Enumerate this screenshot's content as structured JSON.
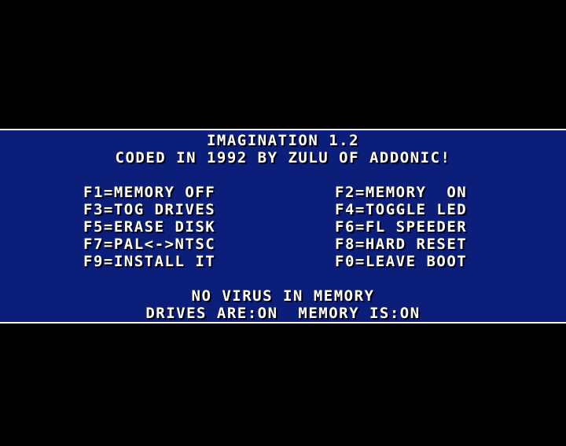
{
  "title": "IMAGINATION 1.2",
  "credit": "CODED IN 1992 BY ZULU OF ADDONIC!",
  "menu": {
    "left": [
      "F1=MEMORY OFF",
      "F3=TOG DRIVES",
      "F5=ERASE DISK",
      "F7=PAL<->NTSC",
      "F9=INSTALL IT"
    ],
    "right": [
      "F2=MEMORY  ON",
      "F4=TOGGLE LED",
      "F6=FL SPEEDER",
      "F8=HARD RESET",
      "F0=LEAVE BOOT"
    ]
  },
  "status": {
    "virus": "NO VIRUS IN MEMORY",
    "drives_memory": "DRIVES ARE:ON  MEMORY IS:ON"
  },
  "colors": {
    "background": "#000000",
    "panel": "#0b1f7a",
    "text": "#ffffff",
    "shadow": "#000000"
  }
}
